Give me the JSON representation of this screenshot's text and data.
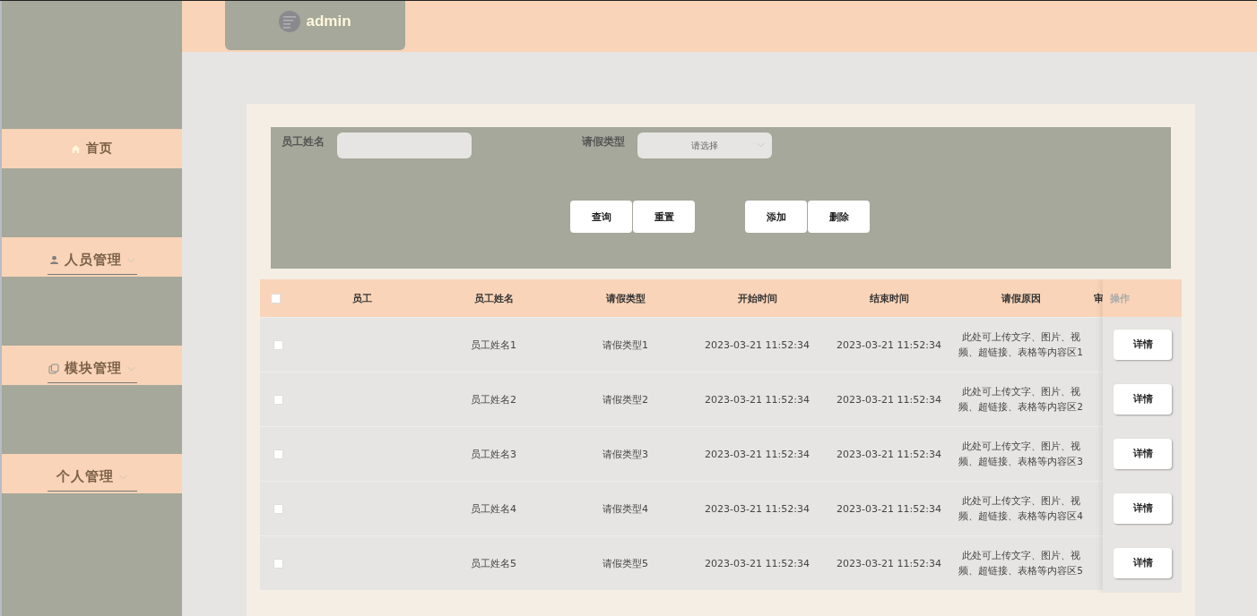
{
  "header": {
    "user": "admin"
  },
  "sidebar": {
    "items": [
      {
        "label": "首页",
        "kind": "link"
      },
      {
        "label": "人员管理",
        "kind": "menu"
      },
      {
        "label": "模块管理",
        "kind": "menu"
      },
      {
        "label": "个人管理",
        "kind": "menu"
      }
    ]
  },
  "search": {
    "fields": [
      {
        "label": "员工姓名",
        "kind": "text"
      },
      {
        "label": "请假类型",
        "kind": "select",
        "placeholder": "请选择"
      }
    ],
    "button_groups": [
      [
        "查询",
        "重置"
      ],
      [
        "添加",
        "删除"
      ]
    ]
  },
  "table": {
    "select_all": {
      "checked": false
    },
    "columns": [
      "员工",
      "员工姓名",
      "请假类型",
      "开始时间",
      "结束时间",
      "请假原因",
      "审"
    ],
    "action_column": "操作",
    "rows": [
      {
        "checked": false,
        "cells": [
          "",
          "员工姓名1",
          "请假类型1",
          "2023-03-21 11:52:34",
          "2023-03-21 11:52:34",
          "此处可上传文字、图片、视频、超链接、表格等内容区1"
        ],
        "action": "详情"
      },
      {
        "checked": false,
        "cells": [
          "",
          "员工姓名2",
          "请假类型2",
          "2023-03-21 11:52:34",
          "2023-03-21 11:52:34",
          "此处可上传文字、图片、视频、超链接、表格等内容区2"
        ],
        "action": "详情"
      },
      {
        "checked": false,
        "cells": [
          "",
          "员工姓名3",
          "请假类型3",
          "2023-03-21 11:52:34",
          "2023-03-21 11:52:34",
          "此处可上传文字、图片、视频、超链接、表格等内容区3"
        ],
        "action": "详情"
      },
      {
        "checked": false,
        "cells": [
          "",
          "员工姓名4",
          "请假类型4",
          "2023-03-21 11:52:34",
          "2023-03-21 11:52:34",
          "此处可上传文字、图片、视频、超链接、表格等内容区4"
        ],
        "action": "详情"
      },
      {
        "checked": false,
        "cells": [
          "",
          "员工姓名5",
          "请假类型5",
          "2023-03-21 11:52:34",
          "2023-03-21 11:52:34",
          "此处可上传文字、图片、视频、超链接、表格等内容区5"
        ],
        "action": "详情"
      }
    ]
  }
}
